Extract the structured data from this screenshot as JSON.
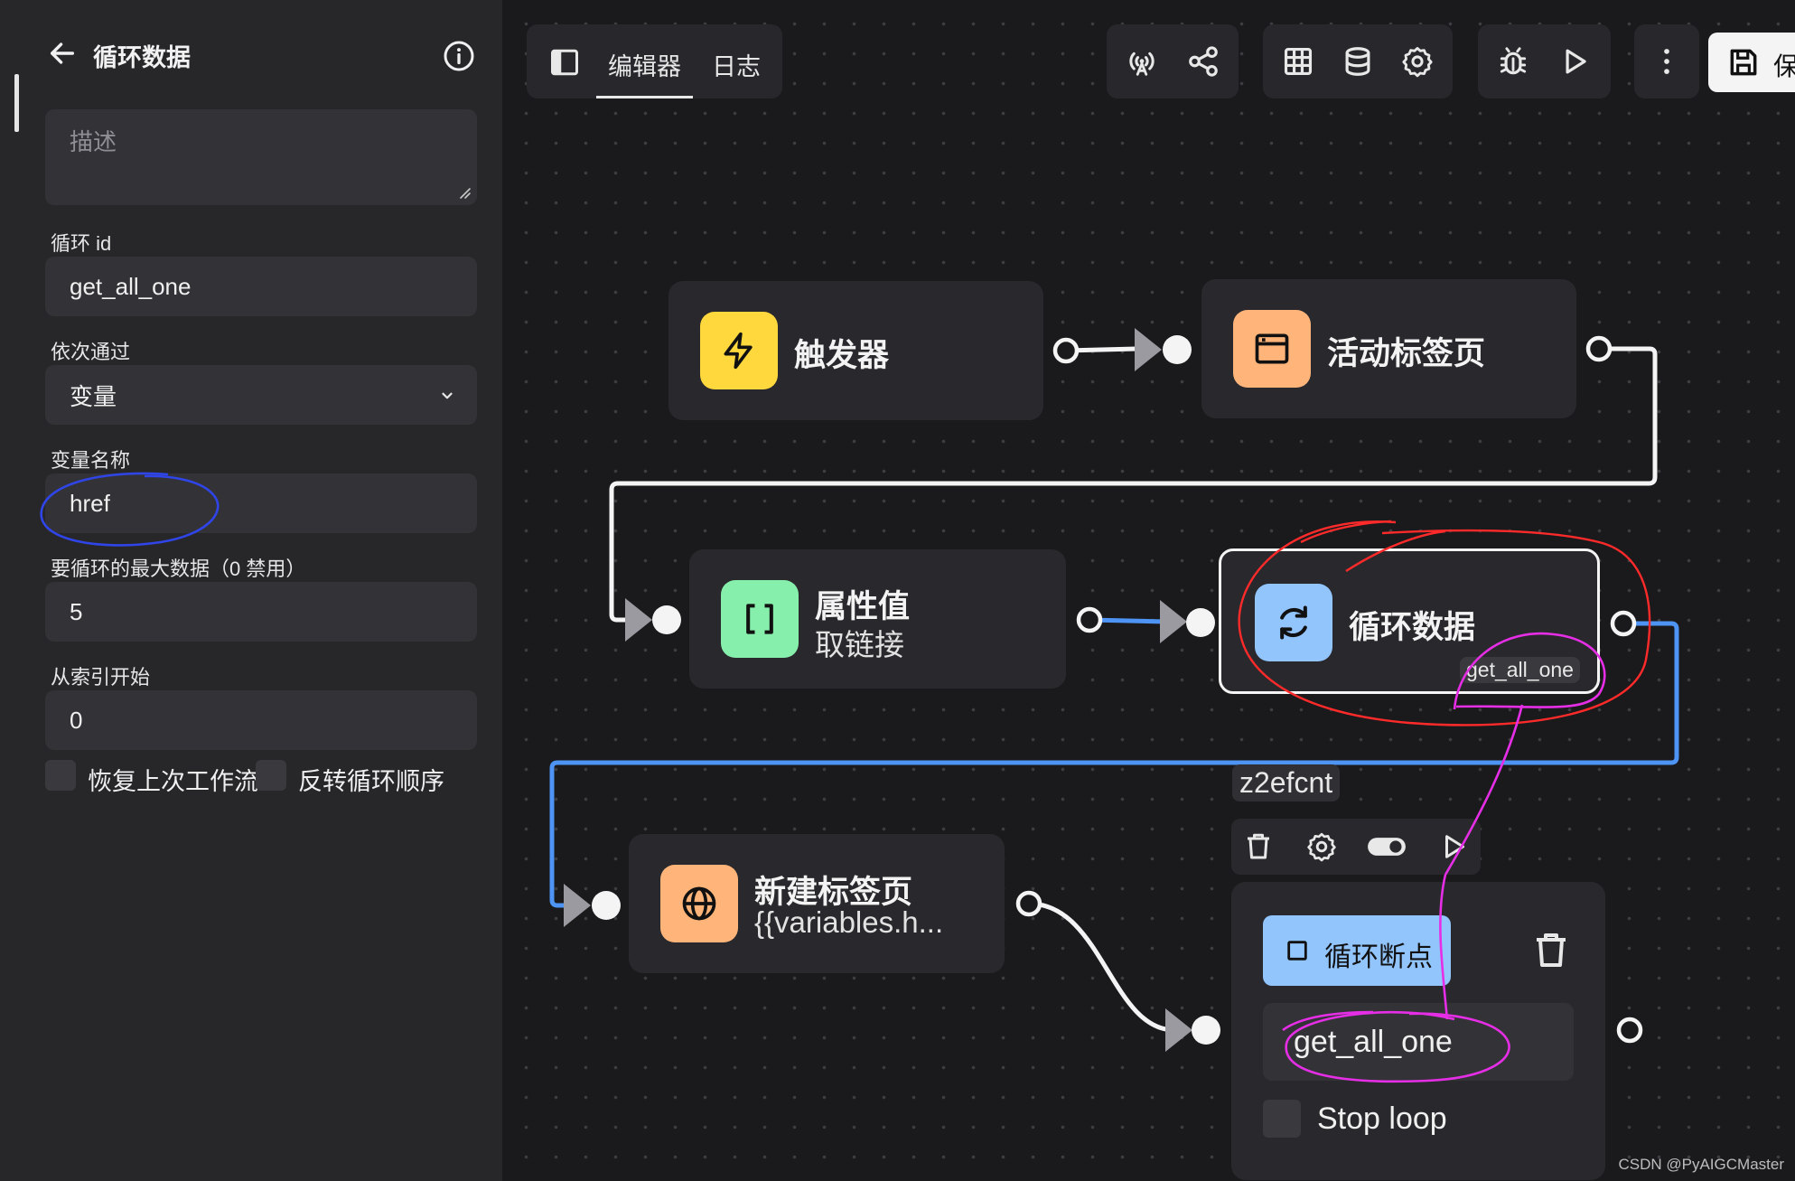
{
  "sidebar": {
    "title": "循环数据",
    "description_placeholder": "描述",
    "loop_id_label": "循环 id",
    "loop_id_value": "get_all_one",
    "loop_through_label": "依次通过",
    "loop_through_value": "变量",
    "variable_name_label": "变量名称",
    "variable_name_value": "href",
    "max_data_label": "要循环的最大数据（0 禁用）",
    "max_data_value": "5",
    "start_index_label": "从索引开始",
    "start_index_value": "0",
    "resume_label": "恢复上次工作流",
    "reverse_label": "反转循环顺序"
  },
  "toolbar": {
    "tab_editor": "编辑器",
    "tab_logs": "日志",
    "save_label": "保"
  },
  "nodes": {
    "trigger": {
      "title": "触发器"
    },
    "active_tab": {
      "title": "活动标签页"
    },
    "attribute": {
      "title": "属性值",
      "subtitle": "取链接"
    },
    "loop_data": {
      "title": "循环数据",
      "badge": "get_all_one"
    },
    "new_tab": {
      "title": "新建标签页",
      "subtitle": "{{variables.h..."
    },
    "group": {
      "id_label": "z2efcnt",
      "breakpoint_label": "循环断点",
      "loop_id_value": "get_all_one",
      "stop_loop_label": "Stop loop"
    }
  },
  "watermark": "CSDN @PyAIGCMaster",
  "colors": {
    "trigger": "#ffd83d",
    "active_tab": "#ffb57a",
    "attribute": "#86efac",
    "loop": "#93c5fd",
    "new_tab": "#ffb57a",
    "active_wire": "#4d94f5",
    "annotation_red": "#ff2a2a",
    "annotation_magenta": "#e62ee6",
    "annotation_blue": "#2f45e8"
  }
}
